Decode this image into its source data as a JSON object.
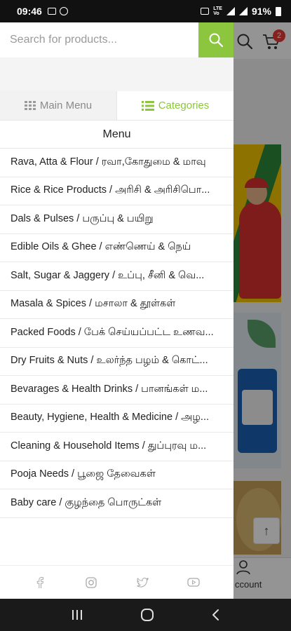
{
  "statusbar": {
    "time": "09:46",
    "battery": "91%"
  },
  "search": {
    "placeholder": "Search for products..."
  },
  "cart": {
    "count": "2"
  },
  "tabs": [
    {
      "label": "Main Menu",
      "icon": "grid-icon",
      "active": false
    },
    {
      "label": "Categories",
      "icon": "list-icon",
      "active": true
    }
  ],
  "menu_title": "Menu",
  "categories": [
    "Rava, Atta & Flour / ரவா,கோதுமை & மாவு",
    "Rice & Rice Products / அரிசி & அரிசிபொ...",
    "Dals & Pulses / பருப்பு & பயிறு",
    "Edible Oils & Ghee / எண்ணெய் & நெய்",
    "Salt, Sugar & Jaggery / உப்பு, சீனி & வெ...",
    "Masala & Spices / மசாலா & தூள்கள்",
    "Packed Foods / பேக் செய்யப்பட்ட உணவ...",
    "Dry Fruits & Nuts / உலர்ந்த பழம் & கொட்...",
    "Bevarages & Health Drinks / பானங்கள் ம...",
    "Beauty, Hygiene, Health & Medicine / அழ...",
    "Cleaning & Household Items / துப்புரவு ம...",
    "Pooja Needs / பூஜை தேவைகள்",
    "Baby care / குழந்தை பொருட்கள்"
  ],
  "background": {
    "account_label": "ccount"
  },
  "colors": {
    "accent": "#8cc63f",
    "badge": "#e53935"
  }
}
